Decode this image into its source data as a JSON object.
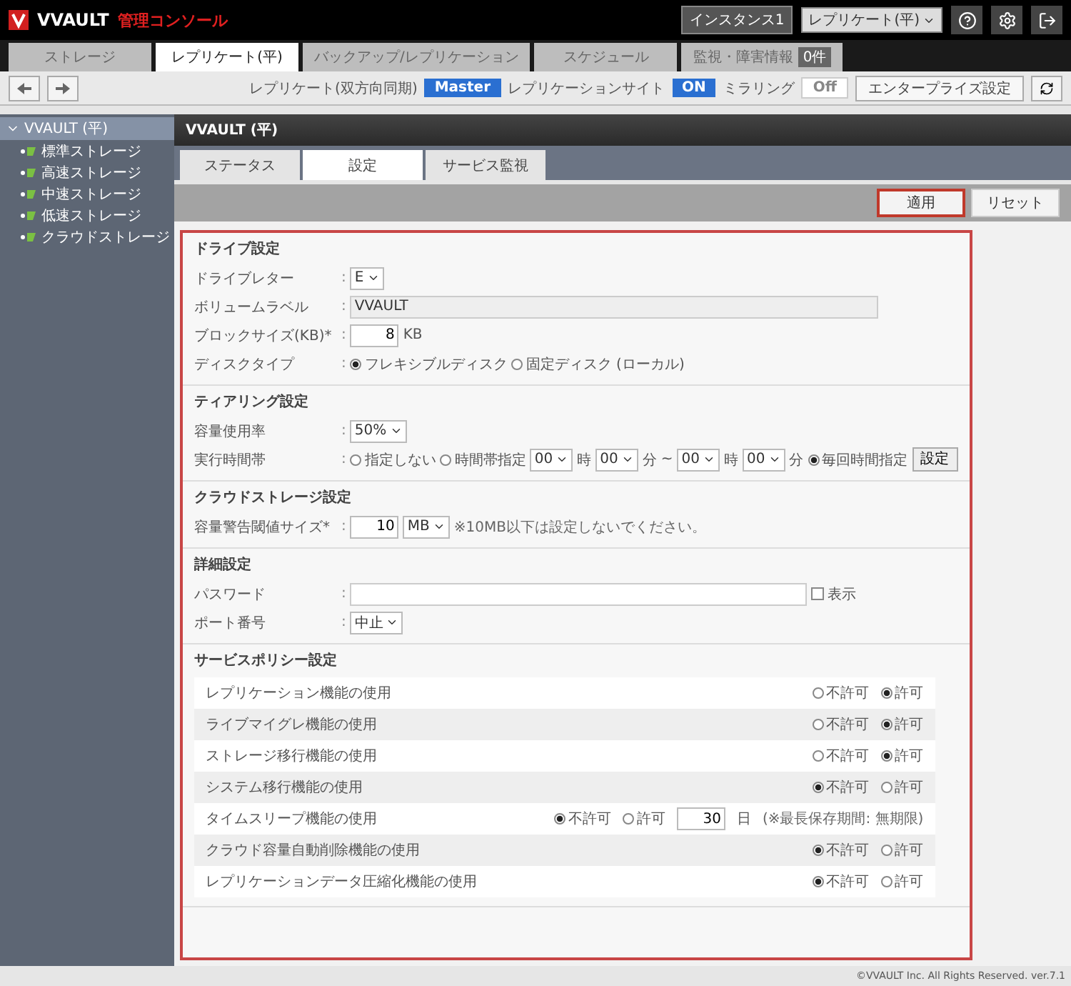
{
  "app": {
    "logo": "VVAULT",
    "title": "管理コンソール"
  },
  "header": {
    "instance_label": "インスタンス1",
    "instance_select": "レプリケート(平)"
  },
  "main_tabs": [
    {
      "label": "ストレージ",
      "selected": false
    },
    {
      "label": "レプリケート(平)",
      "selected": true
    },
    {
      "label": "バックアップ/レプリケーション",
      "selected": false
    },
    {
      "label": "スケジュール",
      "selected": false
    },
    {
      "label": "監視・障害情報",
      "selected": false,
      "badge": "0件"
    }
  ],
  "toolbar": {
    "status": [
      {
        "label": "レプリケート(双方向同期)",
        "value": "Master",
        "on": true
      },
      {
        "label": "レプリケーションサイト",
        "value": "ON",
        "on": true
      },
      {
        "label": "ミラリング",
        "value": "Off",
        "on": false
      }
    ],
    "button": "エンタープライズ設定"
  },
  "sidebar": {
    "root": {
      "label": "VVAULT (平)",
      "expanded": true,
      "selected": true,
      "children": [
        {
          "label": "標準ストレージ"
        },
        {
          "label": "高速ストレージ"
        },
        {
          "label": "中速ストレージ"
        },
        {
          "label": "低速ストレージ"
        },
        {
          "label": "クラウドストレージ"
        }
      ]
    }
  },
  "content": {
    "title": "VVAULT (平)",
    "tabs": [
      {
        "label": "ステータス",
        "selected": false
      },
      {
        "label": "設定",
        "selected": true
      },
      {
        "label": "サービス監視",
        "selected": false
      }
    ],
    "actions": [
      {
        "label": "適用",
        "highlighted": true
      },
      {
        "label": "リセット",
        "highlighted": false
      }
    ]
  },
  "sections": [
    {
      "title": "ドライブ設定",
      "rows": [
        {
          "kind": "select",
          "label": "ドライブレター",
          "colon": ":",
          "value": "E"
        },
        {
          "kind": "text",
          "label": "ボリュームラベル",
          "colon": ":",
          "value": "VVAULT",
          "disabled": true
        },
        {
          "kind": "number",
          "label": "ブロックサイズ(KB)*",
          "colon": ":",
          "value": "8",
          "unit": "KB"
        },
        {
          "kind": "radio",
          "label": "ディスクタイプ",
          "colon": ":",
          "options": [
            {
              "label": "フレキシブルディスク",
              "selected": true
            },
            {
              "label": "固定ディスク (ローカル)",
              "selected": false
            }
          ]
        }
      ]
    },
    {
      "title": "ティアリング設定",
      "rows": [
        {
          "kind": "select",
          "label": "容量使用率",
          "colon": ":",
          "value": "50%"
        },
        {
          "kind": "schedule",
          "label": "実行時間帯",
          "colon": ":",
          "options": [
            {
              "label": "指定しない",
              "selected": false
            },
            {
              "label": "時間帯指定",
              "selected": false
            },
            {
              "label": "毎回時間指定",
              "selected": true
            }
          ],
          "times": [
            {
              "value": "00",
              "unit": "時"
            },
            {
              "value": "00",
              "unit": "分"
            },
            {
              "value": "00",
              "unit": "時"
            },
            {
              "value": "00",
              "unit": "分"
            }
          ],
          "separator": "~",
          "button": "設定"
        }
      ]
    },
    {
      "title": "クラウドストレージ設定",
      "rows": [
        {
          "kind": "size",
          "label": "容量警告閾値サイズ*",
          "colon": ":",
          "value": "10",
          "unit": "MB",
          "note": "※10MB以下は設定しないでください。"
        }
      ]
    },
    {
      "title": "詳細設定",
      "rows": [
        {
          "kind": "password",
          "label": "パスワード",
          "colon": ":",
          "checkbox": {
            "label": "表示",
            "checked": false
          }
        },
        {
          "kind": "select",
          "label": "ポート番号",
          "colon": ":",
          "value": "中止"
        }
      ]
    }
  ],
  "policy": {
    "title": "サービスポリシー設定",
    "rows": [
      {
        "label": "レプリケーション機能の使用",
        "options": [
          {
            "label": "不許可",
            "selected": false
          },
          {
            "label": "許可",
            "selected": true
          }
        ]
      },
      {
        "label": "ライブマイグレ機能の使用",
        "options": [
          {
            "label": "不許可",
            "selected": false
          },
          {
            "label": "許可",
            "selected": true
          }
        ]
      },
      {
        "label": "ストレージ移行機能の使用",
        "options": [
          {
            "label": "不許可",
            "selected": false
          },
          {
            "label": "許可",
            "selected": true
          }
        ]
      },
      {
        "label": "システム移行機能の使用",
        "options": [
          {
            "label": "不許可",
            "selected": true
          },
          {
            "label": "許可",
            "selected": false
          }
        ]
      },
      {
        "label": "タイムスリープ機能の使用",
        "options": [
          {
            "label": "不許可",
            "selected": true
          },
          {
            "label": "許可",
            "selected": false
          }
        ],
        "extra": {
          "value": "30",
          "unit": "日",
          "note": "(※最長保存期間: 無期限)"
        }
      },
      {
        "label": "クラウド容量自動削除機能の使用",
        "options": [
          {
            "label": "不許可",
            "selected": true
          },
          {
            "label": "許可",
            "selected": false
          }
        ]
      },
      {
        "label": "レプリケーションデータ圧縮化機能の使用",
        "options": [
          {
            "label": "不許可",
            "selected": true
          },
          {
            "label": "許可",
            "selected": false
          }
        ]
      }
    ]
  },
  "footer": "©VVAULT Inc. All Rights Reserved. ver.7.1"
}
